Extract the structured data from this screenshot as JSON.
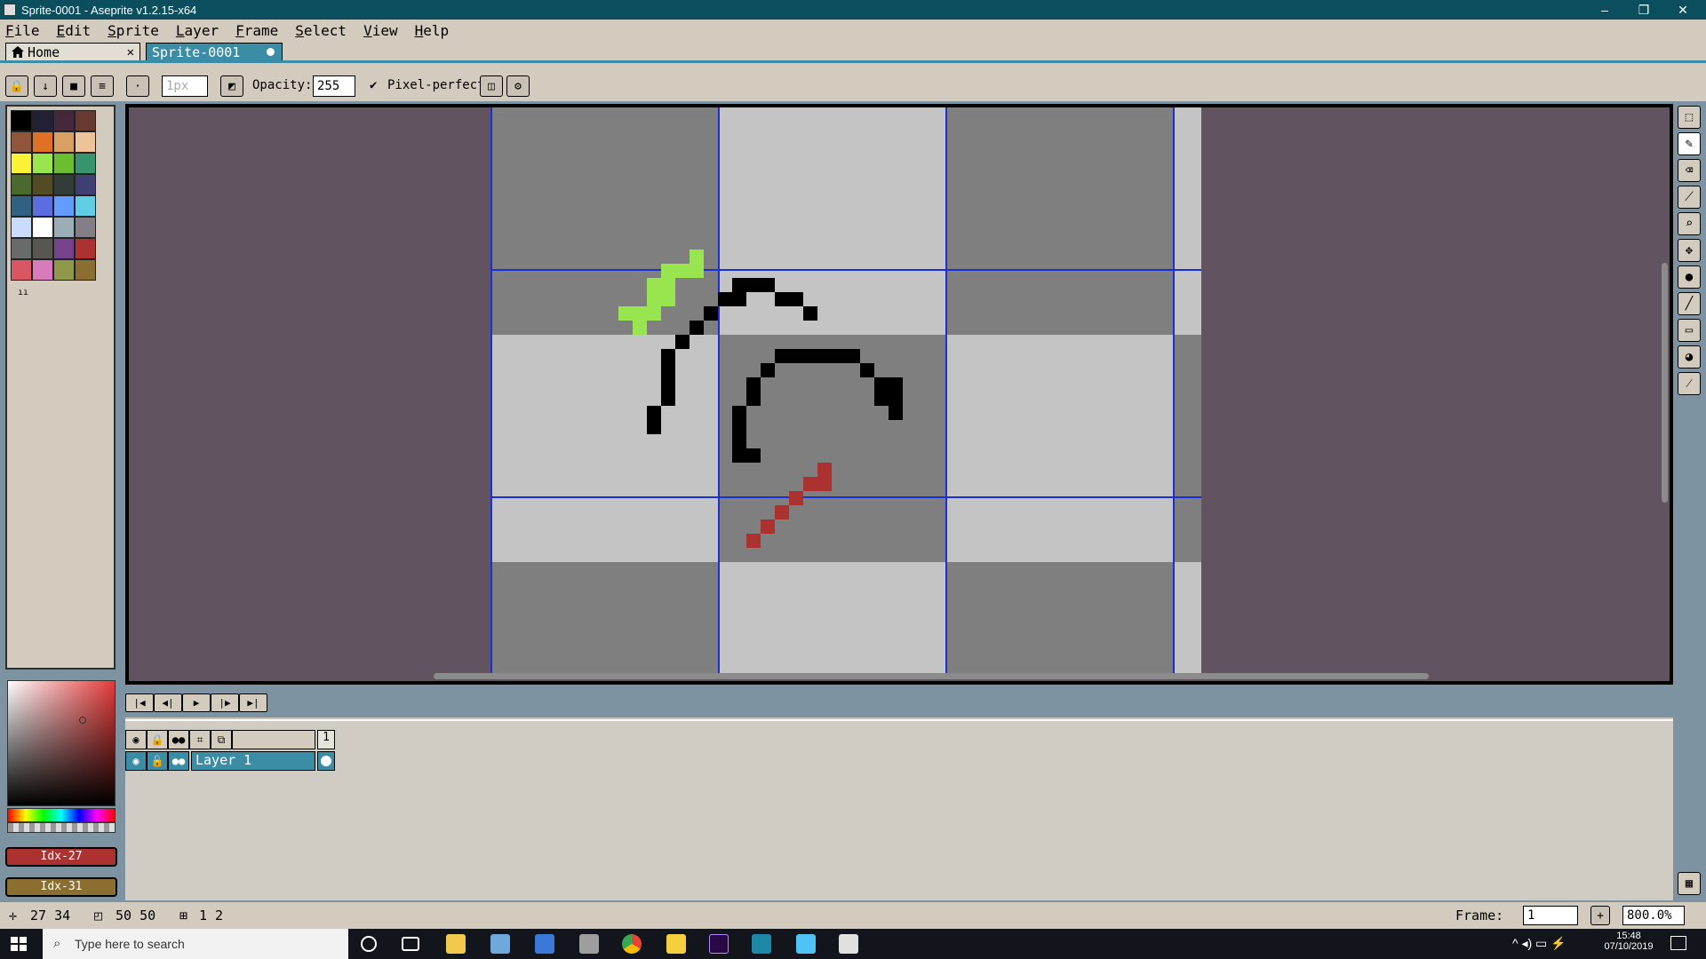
{
  "window": {
    "title": "Sprite-0001 - Aseprite v1.2.15-x64"
  },
  "menu": [
    "File",
    "Edit",
    "Sprite",
    "Layer",
    "Frame",
    "Select",
    "View",
    "Help"
  ],
  "tabs": [
    {
      "label": "Home",
      "icon": "home-icon"
    },
    {
      "label": "Sprite-0001",
      "modified": true
    }
  ],
  "context_bar": {
    "brush_size": "1px",
    "opacity_label": "Opacity:",
    "opacity_value": "255",
    "pixel_perfect_label": "Pixel-perfect",
    "pixel_perfect_checked": true
  },
  "palette": {
    "colors": [
      "#000000",
      "#222034",
      "#45283c",
      "#663931",
      "#8f563b",
      "#df7126",
      "#d9a066",
      "#eec39a",
      "#fbf236",
      "#99e550",
      "#6abe30",
      "#37946e",
      "#4b692f",
      "#524b24",
      "#323c39",
      "#3f3f74",
      "#306082",
      "#5b6ee1",
      "#639bff",
      "#5fcde4",
      "#cbdbfc",
      "#ffffff",
      "#9badb7",
      "#847e87",
      "#696a6a",
      "#595652",
      "#76428a",
      "#ac3232",
      "#d95763",
      "#d77bba",
      "#8f974a",
      "#8a6f30"
    ]
  },
  "colors": {
    "foreground_label": "Idx-27",
    "foreground_color": "#ac3232",
    "background_label": "Idx-31",
    "background_color": "#8a6f30"
  },
  "timeline": {
    "frame_number": "1",
    "layers": [
      {
        "name": "Layer 1",
        "visible": true,
        "locked": false
      }
    ]
  },
  "status": {
    "cursor_pos": "27 34",
    "sprite_size": "50 50",
    "grid": "1 2",
    "frame_label": "Frame:",
    "frame_value": "1",
    "zoom": "800.0%"
  },
  "taskbar": {
    "search_placeholder": "Type here to search",
    "time": "15:48",
    "date": "07/10/2019"
  }
}
